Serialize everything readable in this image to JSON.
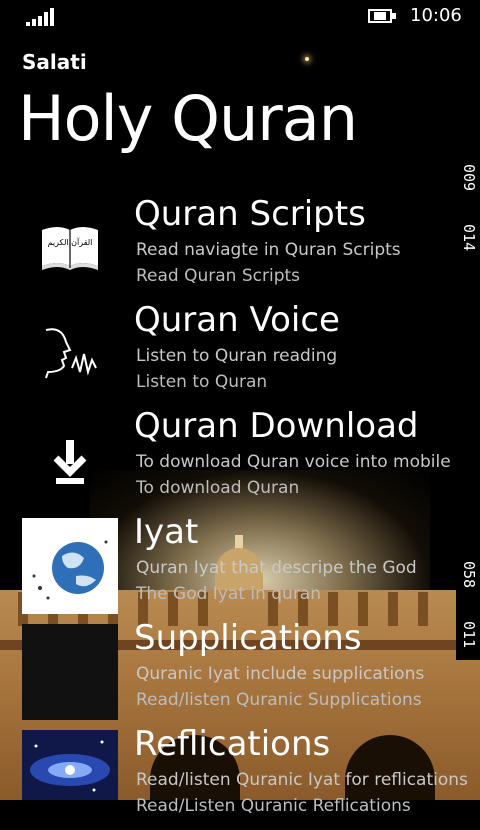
{
  "status_bar": {
    "time": "10:06"
  },
  "app": {
    "name": "Salati",
    "page_title": "Holy Quran"
  },
  "side_counters": {
    "top": [
      "009",
      "014"
    ],
    "bottom": [
      "058",
      "011"
    ]
  },
  "items": [
    {
      "title": "Quran Scripts",
      "description": "Read naviagte in Quran Scripts",
      "subtitle": "Read Quran Scripts",
      "icon": "book-icon",
      "book_text": "القرآن الكريم"
    },
    {
      "title": "Quran Voice",
      "description": "Listen to Quran reading",
      "subtitle": "Listen to Quran",
      "icon": "speaking-voice-icon"
    },
    {
      "title": "Quran Download",
      "description": "To download Quran voice into mobile",
      "subtitle": "To download Quran",
      "icon": "download-icon"
    },
    {
      "title": "Iyat",
      "description": "Quran Iyat that descripe the God",
      "subtitle": "The God  Iyat in quran",
      "icon": "earth-image"
    },
    {
      "title": "Supplications",
      "description": "Quranic Iyat include supplications",
      "subtitle": "Read/listen Quranic Supplications",
      "icon": "praying-person-image"
    },
    {
      "title": "Reflications",
      "description": "Read/listen Quranic Iyat for reflications",
      "subtitle": "Read/Listen Quranic Reflications",
      "icon": "galaxy-image"
    }
  ]
}
